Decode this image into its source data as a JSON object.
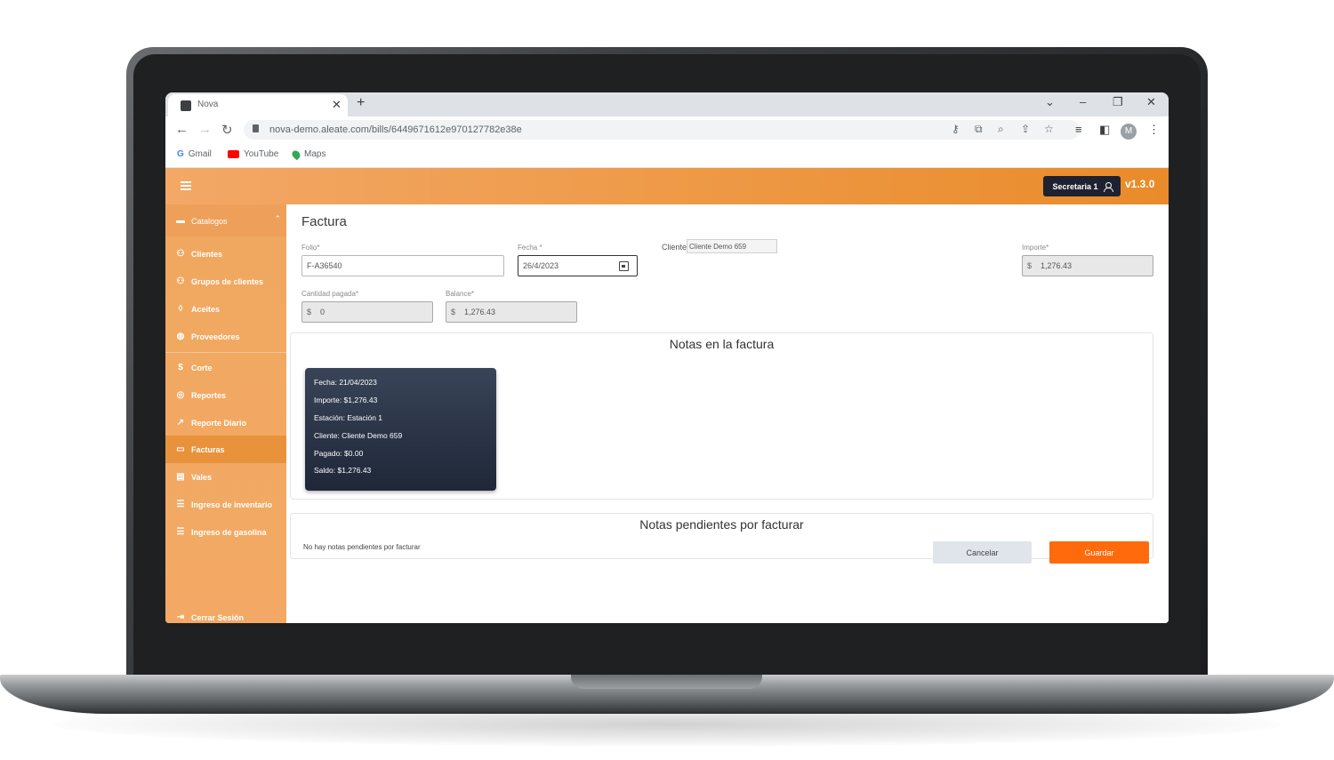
{
  "browser": {
    "tab_title": "Nova",
    "url": "nova-demo.aleate.com/bills/6449671612e970127782e38e",
    "bookmarks": [
      "Gmail",
      "YouTube",
      "Maps"
    ],
    "avatar_initial": "M"
  },
  "header": {
    "user_label": "Secretaria 1",
    "version": "v1.3.0",
    "accent_color": "#e98b2a"
  },
  "sidebar": {
    "section": "Catalogos",
    "items": [
      {
        "label": "Clientes",
        "icon": "users-icon"
      },
      {
        "label": "Grupos de clientes",
        "icon": "users-icon"
      },
      {
        "label": "Aceites",
        "icon": "drop-icon"
      },
      {
        "label": "Proveedores",
        "icon": "globe-icon"
      },
      {
        "label": "Corte",
        "icon": "dollar-icon"
      },
      {
        "label": "Reportes",
        "icon": "radar-icon"
      },
      {
        "label": "Reporte Diario",
        "icon": "trend-icon"
      },
      {
        "label": "Facturas",
        "icon": "monitor-icon",
        "active": true
      },
      {
        "label": "Vales",
        "icon": "card-icon"
      },
      {
        "label": "Ingreso de inventario",
        "icon": "list-icon"
      },
      {
        "label": "Ingreso de gasolina",
        "icon": "list-icon"
      }
    ],
    "logout": "Cerrar Sesión"
  },
  "form": {
    "title": "Factura",
    "folio_label": "Folio",
    "folio": "F-A36540",
    "fecha_label": "Fecha",
    "fecha": "26/4/2023",
    "cliente_label": "Cliente",
    "cliente": "Cliente Demo 659",
    "importe_label": "Importe",
    "importe": "1,276.43",
    "cantidad_label": "Cantidad pagada",
    "cantidad": "0",
    "balance_label": "Balance",
    "balance": "1,276.43",
    "currency": "$",
    "required_mark": "*"
  },
  "notas": {
    "title": "Notas en la factura",
    "card": [
      "Fecha: 21/04/2023",
      "Importe: $1,276.43",
      "Estación: Estación 1",
      "Cliente: Cliente Demo 659",
      "Pagado: $0.00",
      "Saldo: $1,276.43"
    ]
  },
  "pendientes": {
    "title": "Notas pendientes por facturar",
    "empty": "No hay notas pendientes por facturar"
  },
  "actions": {
    "cancel": "Cancelar",
    "save": "Guardar",
    "save_color": "#ff6a0d"
  }
}
